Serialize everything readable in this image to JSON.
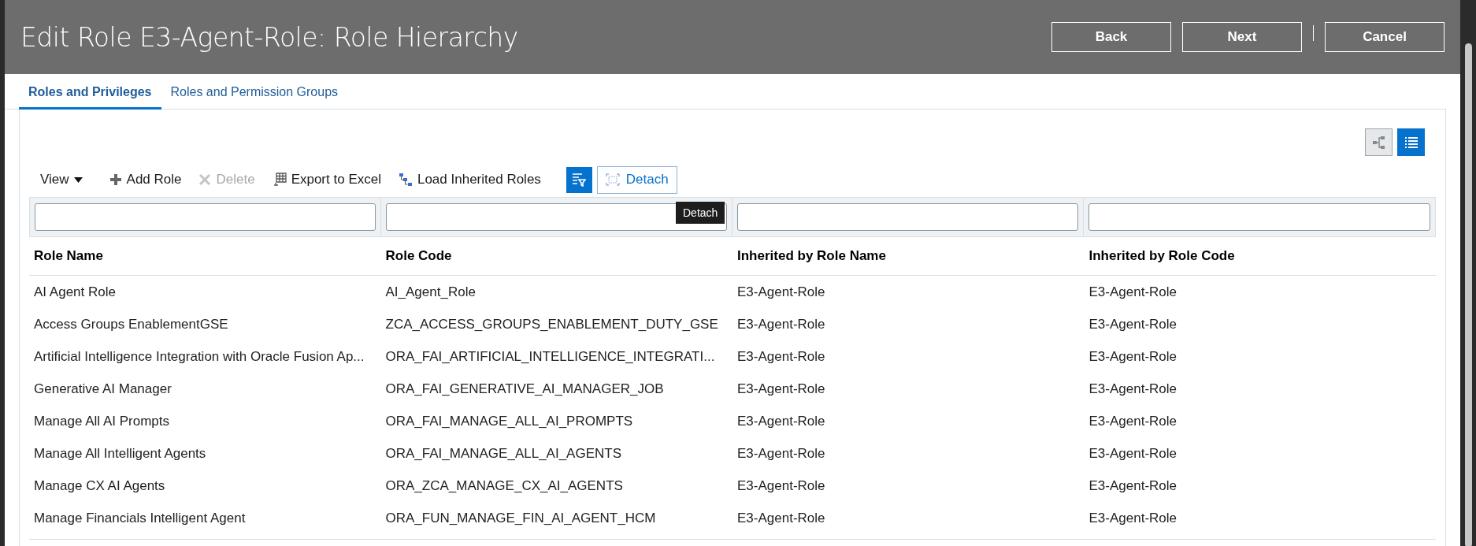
{
  "header": {
    "title": "Edit Role E3-Agent-Role: Role Hierarchy",
    "buttons": [
      "Back",
      "Next",
      "Cancel"
    ]
  },
  "tabs": [
    {
      "label": "Roles and Privileges",
      "selected": true
    },
    {
      "label": "Roles and Permission Groups",
      "selected": false
    }
  ],
  "view_toggle": [
    {
      "kind": "hierarchy",
      "selected": false
    },
    {
      "kind": "list",
      "selected": true
    }
  ],
  "toolbar": {
    "view_menu": "View",
    "items": [
      {
        "kind": "add",
        "label": "Add Role",
        "disabled": false
      },
      {
        "kind": "delete",
        "label": "Delete",
        "disabled": true
      },
      {
        "kind": "export",
        "label": "Export to Excel",
        "disabled": false
      },
      {
        "kind": "load",
        "label": "Load Inherited Roles",
        "disabled": false
      }
    ],
    "filter_toggle": {
      "on": true
    },
    "detach": "Detach",
    "tooltip": "Detach"
  },
  "table": {
    "columns": [
      "Role Name",
      "Role Code",
      "Inherited by Role Name",
      "Inherited by Role Code"
    ],
    "rows": [
      [
        "AI Agent Role",
        "AI_Agent_Role",
        "E3-Agent-Role",
        "E3-Agent-Role"
      ],
      [
        "Access Groups EnablementGSE",
        "ZCA_ACCESS_GROUPS_ENABLEMENT_DUTY_GSE",
        "E3-Agent-Role",
        "E3-Agent-Role"
      ],
      [
        "Artificial Intelligence Integration with Oracle Fusion Ap...",
        "ORA_FAI_ARTIFICIAL_INTELLIGENCE_INTEGRATI...",
        "E3-Agent-Role",
        "E3-Agent-Role"
      ],
      [
        "Generative AI Manager",
        "ORA_FAI_GENERATIVE_AI_MANAGER_JOB",
        "E3-Agent-Role",
        "E3-Agent-Role"
      ],
      [
        "Manage All AI Prompts",
        "ORA_FAI_MANAGE_ALL_AI_PROMPTS",
        "E3-Agent-Role",
        "E3-Agent-Role"
      ],
      [
        "Manage All Intelligent Agents",
        "ORA_FAI_MANAGE_ALL_AI_AGENTS",
        "E3-Agent-Role",
        "E3-Agent-Role"
      ],
      [
        "Manage CX AI Agents",
        "ORA_ZCA_MANAGE_CX_AI_AGENTS",
        "E3-Agent-Role",
        "E3-Agent-Role"
      ],
      [
        "Manage Financials Intelligent Agent",
        "ORA_FUN_MANAGE_FIN_AI_AGENT_HCM",
        "E3-Agent-Role",
        "E3-Agent-Role"
      ]
    ]
  }
}
